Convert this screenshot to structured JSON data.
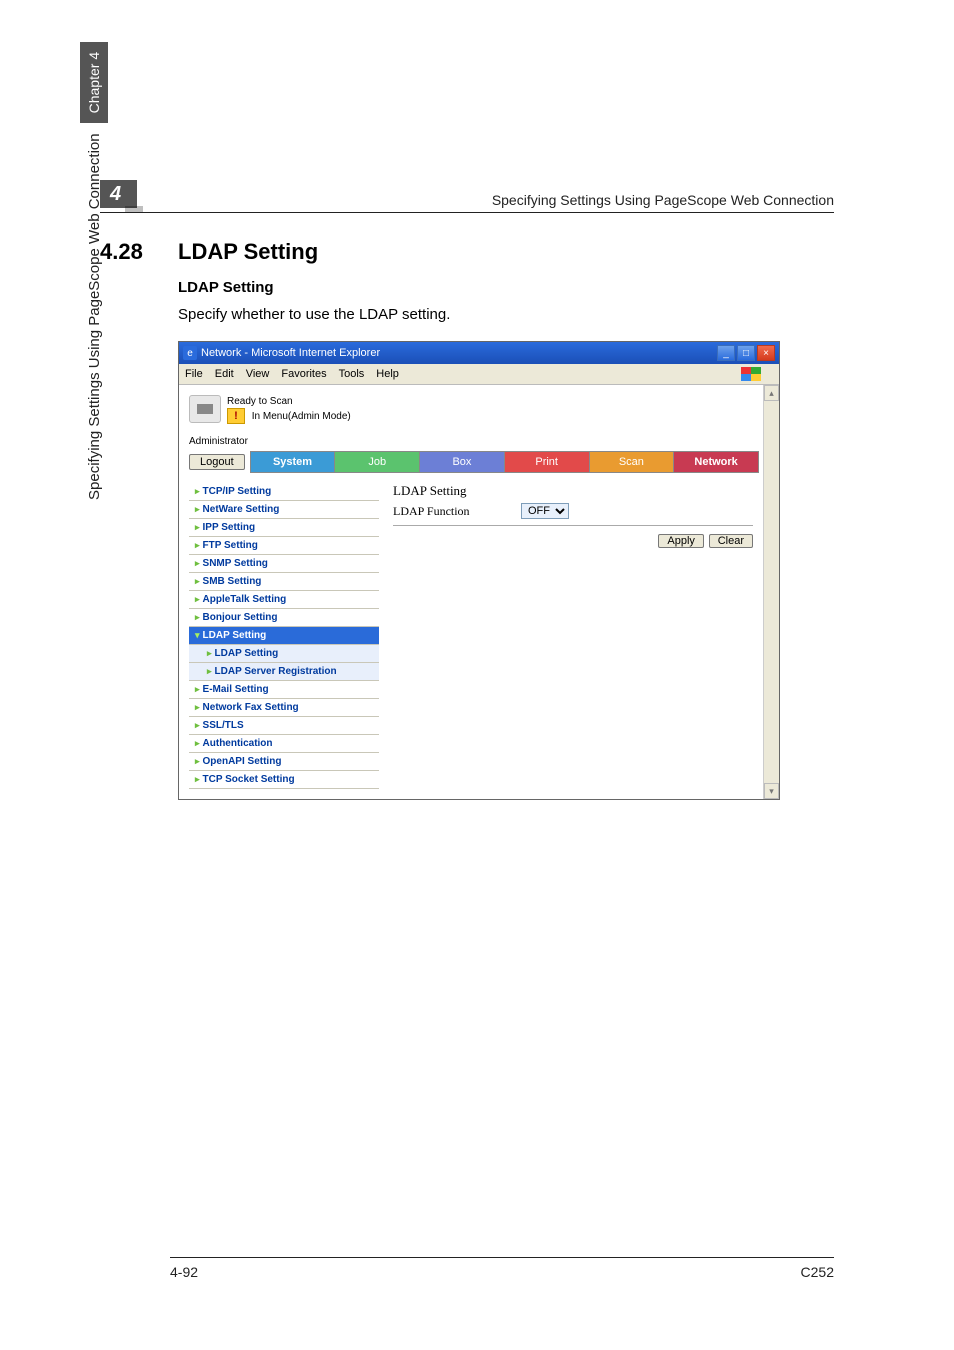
{
  "doc": {
    "chapter_num": "4",
    "header_title": "Specifying Settings Using PageScope Web Connection",
    "section_num": "4.28",
    "section_title": "LDAP Setting",
    "subhead": "LDAP Setting",
    "body": "Specify whether to use the LDAP setting.",
    "side_text": "Specifying Settings Using PageScope Web Connection",
    "side_chapter": "Chapter 4",
    "footer_left": "4-92",
    "footer_right": "C252"
  },
  "window": {
    "title": "Network - Microsoft Internet Explorer",
    "min": "_",
    "max": "□",
    "close": "×"
  },
  "menubar": {
    "file": "File",
    "edit": "Edit",
    "view": "View",
    "favorites": "Favorites",
    "tools": "Tools",
    "help": "Help"
  },
  "status": {
    "line1": "Ready to Scan",
    "line2": "In Menu(Admin Mode)",
    "warn": "!"
  },
  "admin_label": "Administrator",
  "buttons": {
    "logout": "Logout",
    "apply": "Apply",
    "clear": "Clear"
  },
  "tabs": {
    "system": "System",
    "job": "Job",
    "box": "Box",
    "print": "Print",
    "scan": "Scan",
    "network": "Network"
  },
  "sidebar": {
    "tcpip": "TCP/IP Setting",
    "netware": "NetWare Setting",
    "ipp": "IPP Setting",
    "ftp": "FTP Setting",
    "snmp": "SNMP Setting",
    "smb": "SMB Setting",
    "appletalk": "AppleTalk Setting",
    "bonjour": "Bonjour Setting",
    "ldap": "LDAP Setting",
    "ldap_sub1": "LDAP Setting",
    "ldap_sub2": "LDAP Server Registration",
    "email": "E-Mail Setting",
    "netfax": "Network Fax Setting",
    "ssltls": "SSL/TLS",
    "auth": "Authentication",
    "openapi": "OpenAPI Setting",
    "tcpsocket": "TCP Socket Setting"
  },
  "mainpanel": {
    "title": "LDAP Setting",
    "field_label": "LDAP Function",
    "select_value": "OFF"
  }
}
